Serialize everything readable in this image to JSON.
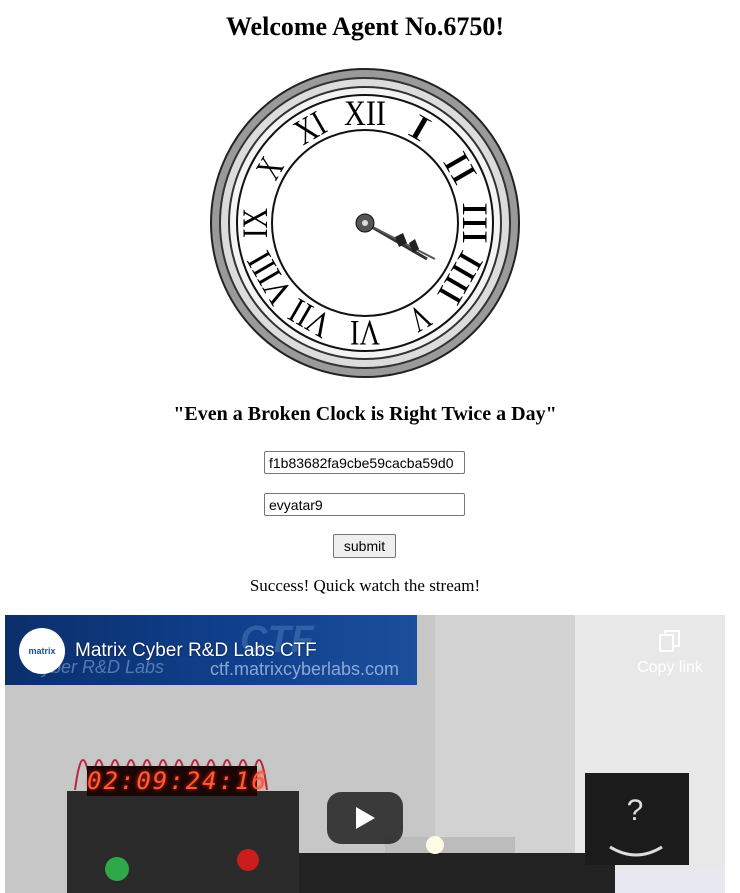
{
  "page": {
    "heading": "Welcome Agent No.6750!",
    "quote": "\"Even a Broken Clock is Right Twice a Day\"",
    "status": "Success! Quick watch the stream!"
  },
  "form": {
    "hash_value": "f1b83682fa9cbe59cacba59d0",
    "username_value": "evyatar9",
    "submit_label": "submit"
  },
  "clock": {
    "numerals": [
      "XII",
      "I",
      "II",
      "III",
      "IIII",
      "V",
      "VI",
      "VII",
      "VIII",
      "IX",
      "X",
      "XI"
    ]
  },
  "video": {
    "title": "Matrix Cyber R&D Labs CTF",
    "copy_link_label": "Copy link",
    "channel_logo_text": "matrix",
    "banner_left_text": "Cyber R&D Labs",
    "banner_url_text": "ctf.matrixcyberlabs.com",
    "banner_ctf_text": "CTF",
    "led_display": "02:09:24:16",
    "box_mark": "?"
  },
  "colors": {
    "banner_blue": "#10418f",
    "led_red": "#ff5a3a"
  }
}
